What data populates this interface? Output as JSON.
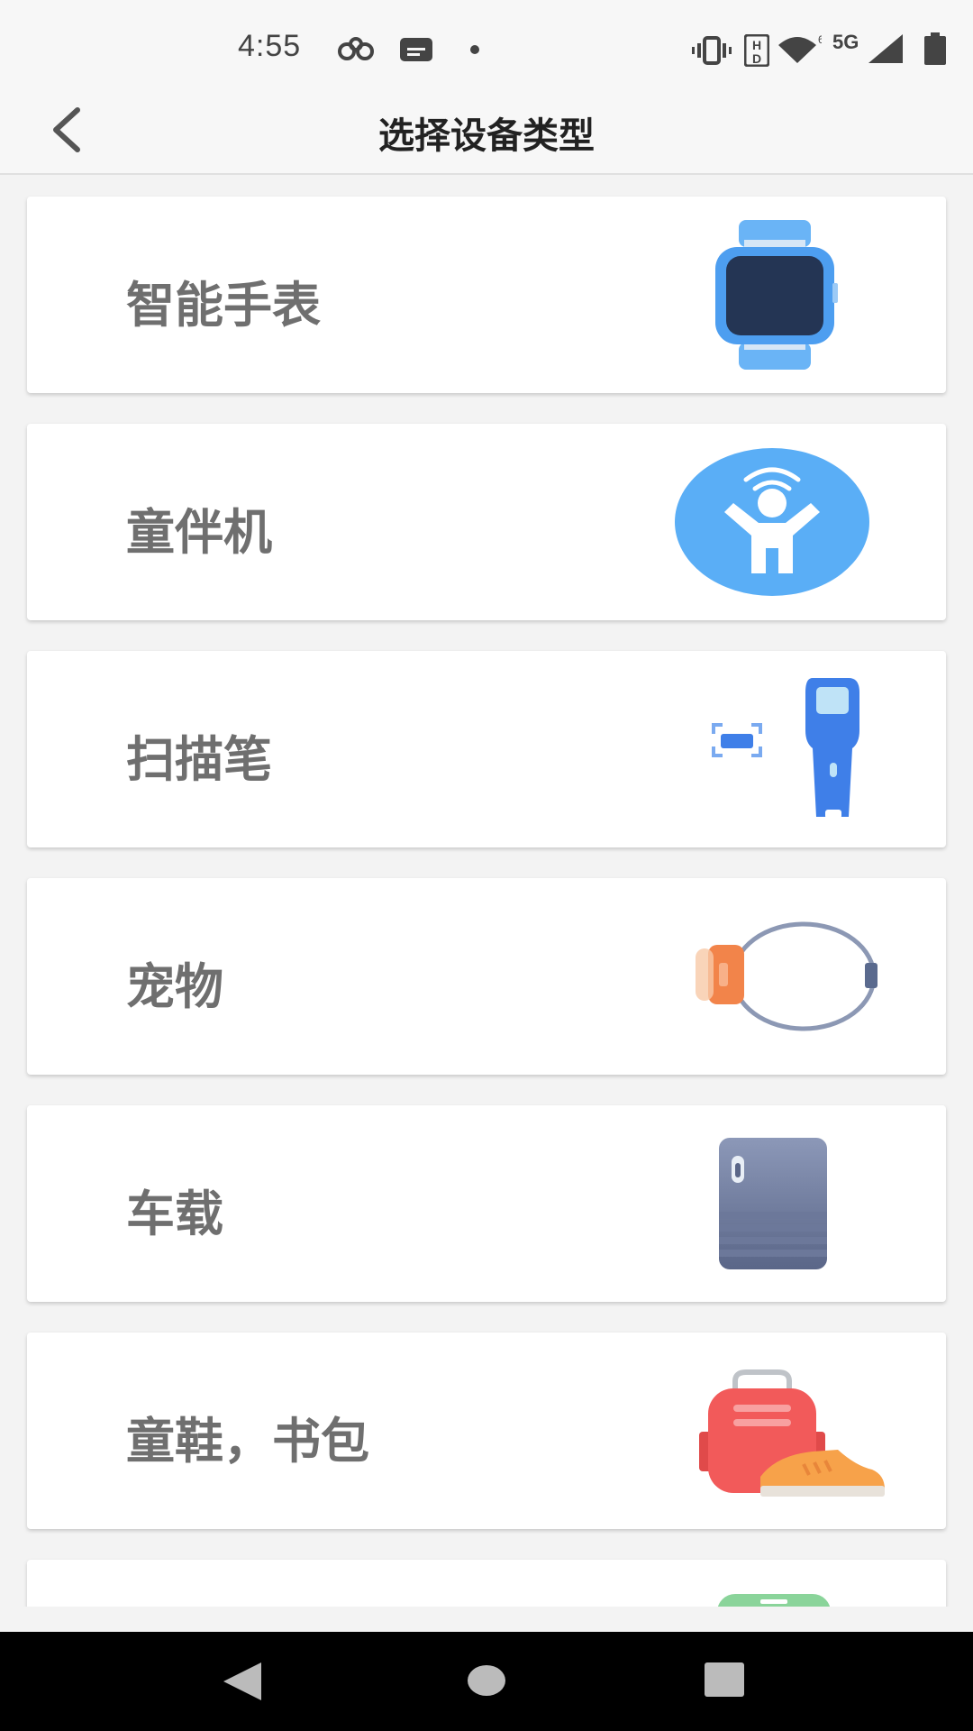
{
  "status_bar": {
    "time": "4:55",
    "icons": [
      "infinity-icon",
      "message-icon",
      "dot-icon",
      "vibrate-icon",
      "hd-icon",
      "wifi-icon",
      "signal-icon",
      "battery-icon"
    ],
    "network": "5G"
  },
  "header": {
    "title": "选择设备类型"
  },
  "device_types": [
    {
      "label": "智能手表",
      "icon": "smartwatch-icon"
    },
    {
      "label": "童伴机",
      "icon": "child-companion-icon"
    },
    {
      "label": "扫描笔",
      "icon": "scan-pen-icon"
    },
    {
      "label": "宠物",
      "icon": "pet-collar-icon"
    },
    {
      "label": "车载",
      "icon": "car-device-icon"
    },
    {
      "label": "童鞋，书包",
      "icon": "shoe-bag-icon"
    },
    {
      "label": "",
      "icon": "partial-device-icon"
    }
  ],
  "colors": {
    "accent_blue": "#5aaef6",
    "label_gray": "#6f6f6f",
    "title": "#222222"
  }
}
